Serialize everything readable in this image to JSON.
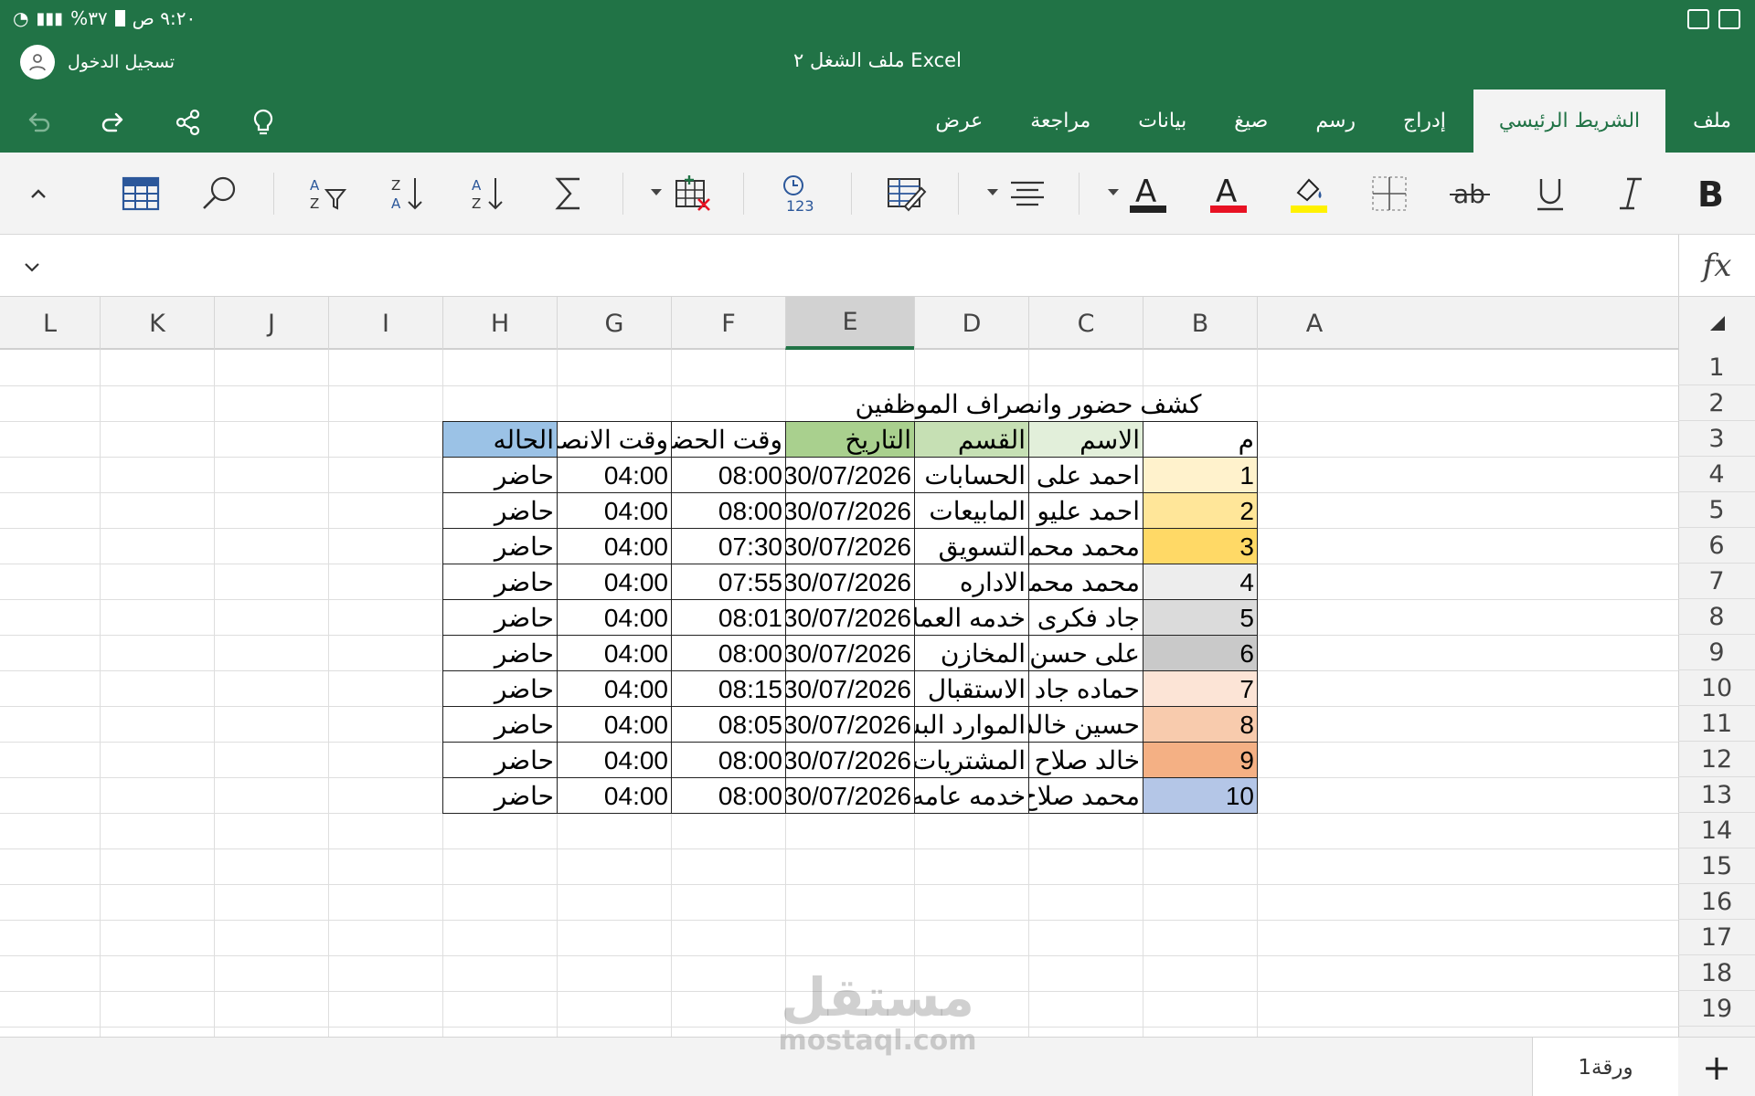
{
  "status": {
    "time": "٩:٢٠ ص",
    "battery": "٣٧%"
  },
  "app": {
    "doc_title": "ملف الشغل ٢ Excel",
    "signin_label": "تسجيل الدخول"
  },
  "tabs": [
    {
      "label": "ملف",
      "active": false
    },
    {
      "label": "الشريط الرئيسي",
      "active": true
    },
    {
      "label": "إدراج",
      "active": false
    },
    {
      "label": "رسم",
      "active": false
    },
    {
      "label": "صيغ",
      "active": false
    },
    {
      "label": "بيانات",
      "active": false
    },
    {
      "label": "مراجعة",
      "active": false
    },
    {
      "label": "عرض",
      "active": false
    }
  ],
  "ribbon": {
    "bold": "B",
    "italic": "I",
    "underline": "U",
    "strike": "ab",
    "font_color": "A",
    "font_color_swatch": "#e81123",
    "highlight_swatch": "#fff100",
    "text_color_swatch": "#222222"
  },
  "formula": {
    "fx": "fx",
    "value": ""
  },
  "columns": [
    "A",
    "B",
    "C",
    "D",
    "E",
    "F",
    "G",
    "H",
    "I",
    "J",
    "K",
    "L"
  ],
  "selected_column": "E",
  "rows": [
    "1",
    "2",
    "3",
    "4",
    "5",
    "6",
    "7",
    "8",
    "9",
    "10",
    "11",
    "12",
    "13",
    "14",
    "15",
    "16",
    "17",
    "18",
    "19"
  ],
  "sheet": {
    "title": "كشف حضور وانصراف الموظفين",
    "headers": {
      "num": "م",
      "name": "الاسم",
      "dept": "القسم",
      "date": "التاريخ",
      "in": "وقت الحضور",
      "out": "وقت الانصراف",
      "status": "الحاله"
    },
    "header_colors": {
      "num": "#ffffff",
      "name": "#e2efda",
      "dept": "#c6e0b4",
      "date": "#a9d08e",
      "in": "#ffffff",
      "out": "#ffffff",
      "status": "#9bc2e6"
    },
    "records": [
      {
        "num": "1",
        "name": "احمد على",
        "dept": "الحسابات",
        "date": "30/07/2026",
        "in": "08:00",
        "out": "04:00",
        "status": "حاضر",
        "num_color": "#fff2cc"
      },
      {
        "num": "2",
        "name": "احمد عليو",
        "dept": "المابيعات",
        "date": "30/07/2026",
        "in": "08:00",
        "out": "04:00",
        "status": "حاضر",
        "num_color": "#ffe699"
      },
      {
        "num": "3",
        "name": "محمد محمد",
        "dept": "التسويق",
        "date": "30/07/2026",
        "in": "07:30",
        "out": "04:00",
        "status": "حاضر",
        "num_color": "#ffd966"
      },
      {
        "num": "4",
        "name": "محمد محمود",
        "dept": "الاداره",
        "date": "30/07/2026",
        "in": "07:55",
        "out": "04:00",
        "status": "حاضر",
        "num_color": "#ededed"
      },
      {
        "num": "5",
        "name": "جاد فكرى",
        "dept": "خدمه العملاء",
        "date": "30/07/2026",
        "in": "08:01",
        "out": "04:00",
        "status": "حاضر",
        "num_color": "#dbdbdb"
      },
      {
        "num": "6",
        "name": "على حسن",
        "dept": "المخازن",
        "date": "30/07/2026",
        "in": "08:00",
        "out": "04:00",
        "status": "حاضر",
        "num_color": "#c9c9c9"
      },
      {
        "num": "7",
        "name": "حماده جاد",
        "dept": "الاستقبال",
        "date": "30/07/2026",
        "in": "08:15",
        "out": "04:00",
        "status": "حاضر",
        "num_color": "#fce4d6"
      },
      {
        "num": "8",
        "name": "حسين خالد",
        "dept": "الموارد البشر",
        "date": "30/07/2026",
        "in": "08:05",
        "out": "04:00",
        "status": "حاضر",
        "num_color": "#f8cbad"
      },
      {
        "num": "9",
        "name": "خالد صلاح",
        "dept": "المشتريات",
        "date": "30/07/2026",
        "in": "08:00",
        "out": "04:00",
        "status": "حاضر",
        "num_color": "#f4b084"
      },
      {
        "num": "10",
        "name": "محمد صلاح",
        "dept": "خدمه عامه",
        "date": "30/07/2026",
        "in": "08:00",
        "out": "04:00",
        "status": "حاضر",
        "num_color": "#b4c6e7"
      }
    ]
  },
  "sheetbar": {
    "tab_label": "ورقة1",
    "add_label": "+"
  },
  "watermark": {
    "line1": "مستقل",
    "line2": "mostaql.com"
  }
}
